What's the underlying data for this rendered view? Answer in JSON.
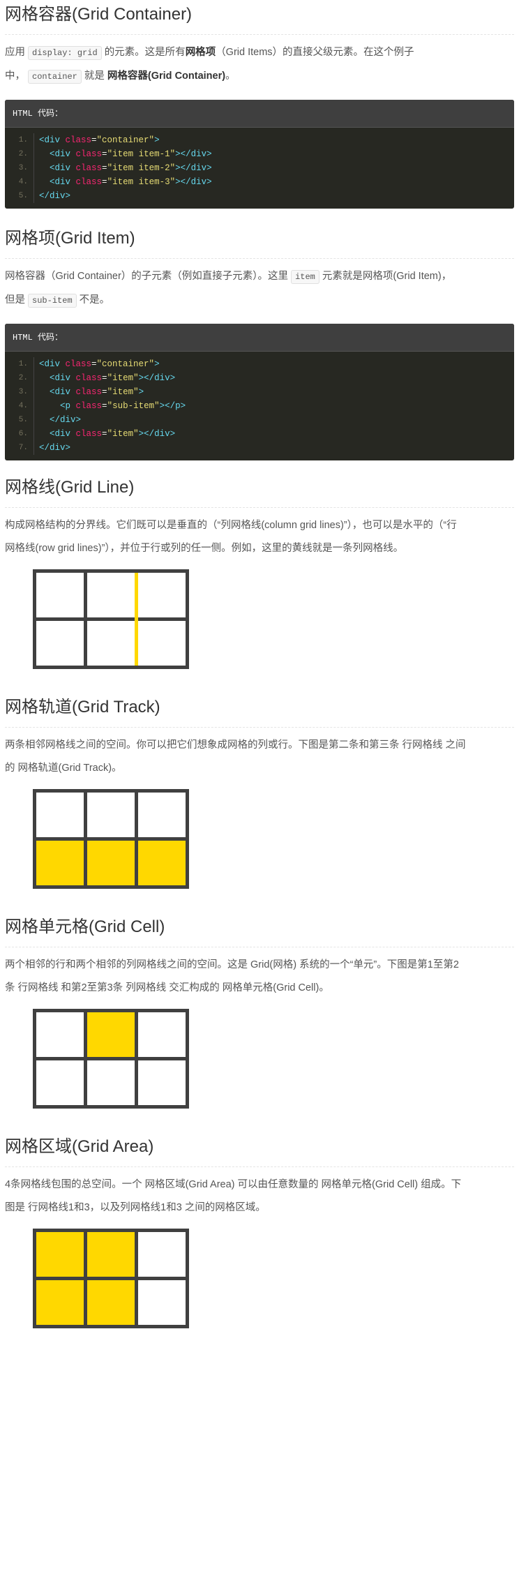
{
  "sections": {
    "container": {
      "title": "网格容器(Grid Container)",
      "p1": "应用",
      "code1": "display: grid",
      "p2": "的元素。这是所有",
      "bold1": "网格项",
      "p3": "（Grid Items）的直接父级元素。在这个例子",
      "p4": "中，",
      "code2": "container",
      "p5": "就是",
      "bold2": "网格容器(Grid Container)",
      "p6": "。",
      "code_title": "HTML 代码：",
      "lines": [
        {
          "n": "1.",
          "parts": [
            [
              "tag",
              "<div "
            ],
            [
              "attr",
              "class"
            ],
            [
              "punct",
              "="
            ],
            [
              "str",
              "\"container\""
            ],
            [
              "tag",
              ">"
            ]
          ]
        },
        {
          "n": "2.",
          "parts": [
            [
              "punct",
              "  "
            ],
            [
              "tag",
              "<div "
            ],
            [
              "attr",
              "class"
            ],
            [
              "punct",
              "="
            ],
            [
              "str",
              "\"item item-1\""
            ],
            [
              "tag",
              "></div>"
            ]
          ]
        },
        {
          "n": "3.",
          "parts": [
            [
              "punct",
              "  "
            ],
            [
              "tag",
              "<div "
            ],
            [
              "attr",
              "class"
            ],
            [
              "punct",
              "="
            ],
            [
              "str",
              "\"item item-2\""
            ],
            [
              "tag",
              "></div>"
            ]
          ]
        },
        {
          "n": "4.",
          "parts": [
            [
              "punct",
              "  "
            ],
            [
              "tag",
              "<div "
            ],
            [
              "attr",
              "class"
            ],
            [
              "punct",
              "="
            ],
            [
              "str",
              "\"item item-3\""
            ],
            [
              "tag",
              "></div>"
            ]
          ]
        },
        {
          "n": "5.",
          "parts": [
            [
              "tag",
              "</div>"
            ]
          ]
        }
      ]
    },
    "item": {
      "title": "网格项(Grid Item)",
      "p1": "网格容器（Grid Container）的子元素（例如直接子元素）。这里",
      "code1": "item",
      "p2": "元素就是网格项(Grid Item)，",
      "p3": "但是",
      "code2": "sub-item",
      "p4": "不是。",
      "code_title": "HTML 代码：",
      "lines": [
        {
          "n": "1.",
          "parts": [
            [
              "tag",
              "<div "
            ],
            [
              "attr",
              "class"
            ],
            [
              "punct",
              "="
            ],
            [
              "str",
              "\"container\""
            ],
            [
              "tag",
              ">"
            ]
          ]
        },
        {
          "n": "2.",
          "parts": [
            [
              "punct",
              "  "
            ],
            [
              "tag",
              "<div "
            ],
            [
              "attr",
              "class"
            ],
            [
              "punct",
              "="
            ],
            [
              "str",
              "\"item\""
            ],
            [
              "tag",
              "></div>"
            ]
          ]
        },
        {
          "n": "3.",
          "parts": [
            [
              "punct",
              "  "
            ],
            [
              "tag",
              "<div "
            ],
            [
              "attr",
              "class"
            ],
            [
              "punct",
              "="
            ],
            [
              "str",
              "\"item\""
            ],
            [
              "tag",
              ">"
            ]
          ]
        },
        {
          "n": "4.",
          "parts": [
            [
              "punct",
              "    "
            ],
            [
              "tag",
              "<p "
            ],
            [
              "attr",
              "class"
            ],
            [
              "punct",
              "="
            ],
            [
              "str",
              "\"sub-item\""
            ],
            [
              "tag",
              "></p>"
            ]
          ]
        },
        {
          "n": "5.",
          "parts": [
            [
              "punct",
              "  "
            ],
            [
              "tag",
              "</div>"
            ]
          ]
        },
        {
          "n": "6.",
          "parts": [
            [
              "punct",
              "  "
            ],
            [
              "tag",
              "<div "
            ],
            [
              "attr",
              "class"
            ],
            [
              "punct",
              "="
            ],
            [
              "str",
              "\"item\""
            ],
            [
              "tag",
              "></div>"
            ]
          ]
        },
        {
          "n": "7.",
          "parts": [
            [
              "tag",
              "</div>"
            ]
          ]
        }
      ]
    },
    "line": {
      "title": "网格线(Grid Line)",
      "p1": "构成网格结构的分界线。它们既可以是垂直的（“列网格线(column grid lines)”），也可以是水平的（“行",
      "p2": "网格线(row grid lines)”），并位于行或列的任一侧。例如，这里的黄线就是一条列网格线。"
    },
    "track": {
      "title": "网格轨道(Grid Track)",
      "p1": "两条相邻网格线之间的空间。你可以把它们想象成网格的列或行。下图是第二条和第三条 行网格线 之间",
      "p2": "的 网格轨道(Grid Track)。"
    },
    "cell": {
      "title": "网格单元格(Grid Cell)",
      "p1": "两个相邻的行和两个相邻的列网格线之间的空间。这是 Grid(网格) 系统的一个“单元”。下图是第1至第2",
      "p2": "条 行网格线 和第2至第3条 列网格线 交汇构成的 网格单元格(Grid Cell)。"
    },
    "area": {
      "title": "网格区域(Grid Area)",
      "p1": "4条网格线包围的总空间。一个 网格区域(Grid Area) 可以由任意数量的 网格单元格(Grid Cell) 组成。下",
      "p2": "图是 行网格线1和3，以及列网格线1和3 之间的网格区域。"
    }
  },
  "figures": {
    "line": {
      "rows": 2,
      "cols": 3,
      "highlight_cells": [],
      "highlight_column_line": 3
    },
    "track": {
      "rows": 2,
      "cols": 3,
      "highlight_cells": [
        [
          2,
          1
        ],
        [
          2,
          2
        ],
        [
          2,
          3
        ]
      ]
    },
    "cell": {
      "rows": 2,
      "cols": 3,
      "highlight_cells": [
        [
          1,
          2
        ]
      ]
    },
    "area": {
      "rows": 2,
      "cols": 3,
      "highlight_cells": [
        [
          1,
          1
        ],
        [
          1,
          2
        ],
        [
          2,
          1
        ],
        [
          2,
          2
        ]
      ]
    }
  },
  "colors": {
    "highlight": "#ffd800",
    "grid_border": "#404040",
    "code_bg": "#272822",
    "code_header_bg": "#3f3f3f"
  }
}
